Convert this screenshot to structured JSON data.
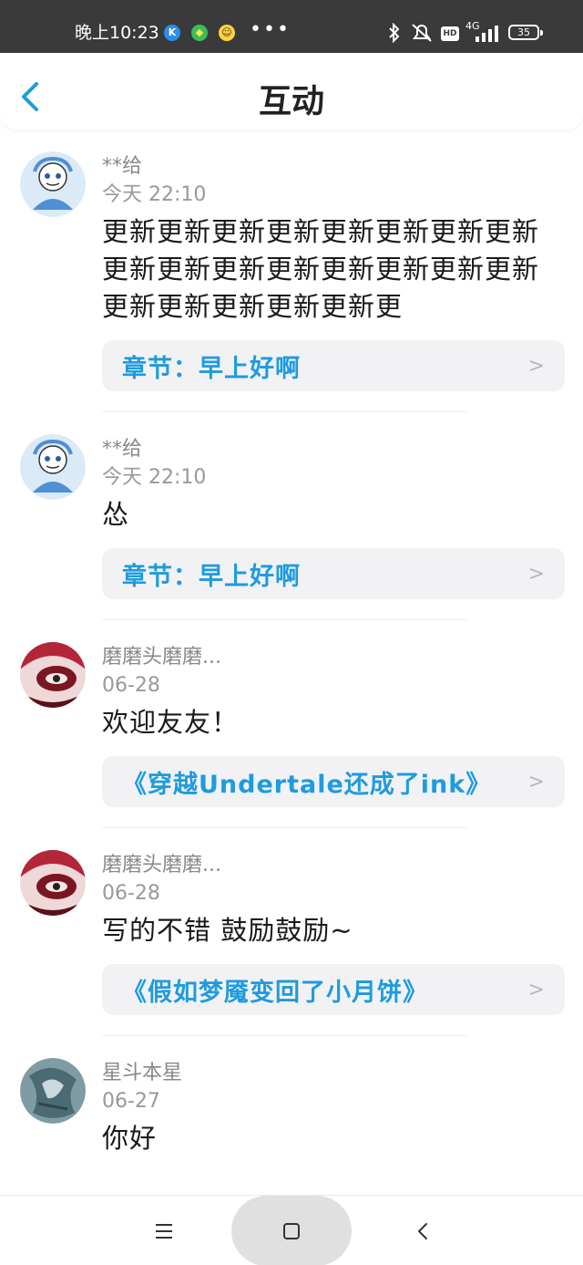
{
  "status_bar": {
    "time": "晚上10:23",
    "dots": "•••",
    "network": "4G",
    "hd": "HD",
    "battery": "35"
  },
  "header": {
    "title": "互动"
  },
  "feed": [
    {
      "username": "**给",
      "time": "今天 22:10",
      "content": "更新更新更新更新更新更新更新更新更新更新更新更新更新更新更新更新更新更新更新更新更新更",
      "ref": "章节：早上好啊"
    },
    {
      "username": "**给",
      "time": "今天 22:10",
      "content": "怂",
      "ref": "章节：早上好啊"
    },
    {
      "username": "磨磨头磨磨...",
      "time": "06-28",
      "content": "欢迎友友！",
      "ref": "《穿越Undertale还成了ink》"
    },
    {
      "username": "磨磨头磨磨...",
      "time": "06-28",
      "content": "写的不错 鼓励鼓励~",
      "ref": "《假如梦魇变回了小月饼》"
    },
    {
      "username": "星斗本星",
      "time": "06-27",
      "content": "你好",
      "ref": ""
    }
  ],
  "colors": {
    "accent": "#1e9be0",
    "status_bar_bg": "#3a3a3a"
  },
  "icons": {
    "back": "chevron-left-icon",
    "ref": "chevron-right-icon",
    "nav_menu": "menu-icon",
    "nav_home": "home-square-icon",
    "nav_back": "back-icon"
  }
}
